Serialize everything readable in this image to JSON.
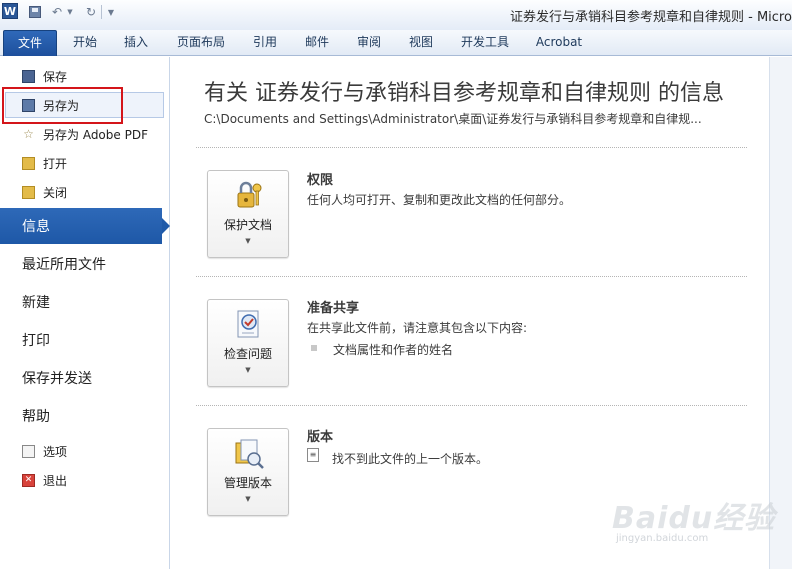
{
  "titlebar": {
    "title": "证券发行与承销科目参考规章和自律规则 - Micro"
  },
  "ribbon": {
    "tabs": [
      "文件",
      "开始",
      "插入",
      "页面布局",
      "引用",
      "邮件",
      "审阅",
      "视图",
      "开发工具",
      "Acrobat"
    ]
  },
  "leftnav": {
    "commands": {
      "save": "保存",
      "save_as": "另存为",
      "save_as_pdf": "另存为 Adobe PDF",
      "open": "打开",
      "close": "关闭"
    },
    "sections": {
      "info": "信息",
      "recent": "最近所用文件",
      "new": "新建",
      "print": "打印",
      "save_send": "保存并发送",
      "help": "帮助"
    },
    "options": "选项",
    "exit": "退出"
  },
  "info": {
    "title": "有关 证券发行与承销科目参考规章和自律规则 的信息",
    "path": "C:\\Documents and Settings\\Administrator\\桌面\\证券发行与承销科目参考规章和自律规..."
  },
  "groups": {
    "permissions": {
      "button_label": "保护文档",
      "title": "权限",
      "description": "任何人均可打开、复制和更改此文档的任何部分。"
    },
    "prepare": {
      "button_label": "检查问题",
      "title": "准备共享",
      "description": "在共享此文件前，请注意其包含以下内容:",
      "bullet": "文档属性和作者的姓名"
    },
    "versions": {
      "button_label": "管理版本",
      "title": "版本",
      "description": "找不到此文件的上一个版本。"
    }
  },
  "watermark": {
    "text": "Baidu经验",
    "url": "jingyan.baidu.com"
  },
  "colors": {
    "accent": "#1e58a7",
    "highlight_box": "#d4151a"
  }
}
